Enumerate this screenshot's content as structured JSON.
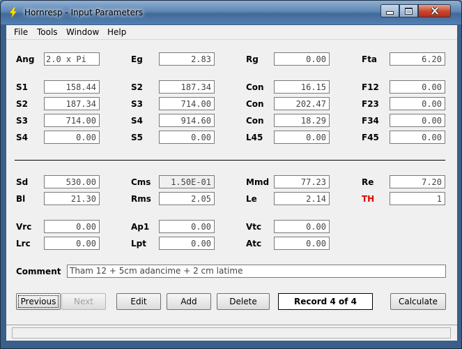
{
  "window": {
    "title": "Hornresp - Input Parameters"
  },
  "menu": [
    "File",
    "Tools",
    "Window",
    "Help"
  ],
  "row1": [
    {
      "label": "Ang",
      "value": "2.0 x Pi"
    },
    {
      "label": "Eg",
      "value": "2.83"
    },
    {
      "label": "Rg",
      "value": "0.00"
    },
    {
      "label": "Fta",
      "value": "6.20"
    }
  ],
  "rows": [
    [
      {
        "label": "S1",
        "value": "158.44"
      },
      {
        "label": "S2",
        "value": "187.34"
      },
      {
        "label": "Con",
        "value": "16.15"
      },
      {
        "label": "F12",
        "value": "0.00"
      }
    ],
    [
      {
        "label": "S2",
        "value": "187.34"
      },
      {
        "label": "S3",
        "value": "714.00"
      },
      {
        "label": "Con",
        "value": "202.47"
      },
      {
        "label": "F23",
        "value": "0.00"
      }
    ],
    [
      {
        "label": "S3",
        "value": "714.00"
      },
      {
        "label": "S4",
        "value": "914.60"
      },
      {
        "label": "Con",
        "value": "18.29"
      },
      {
        "label": "F34",
        "value": "0.00"
      }
    ],
    [
      {
        "label": "S4",
        "value": "0.00"
      },
      {
        "label": "S5",
        "value": "0.00"
      },
      {
        "label": "L45",
        "value": "0.00"
      },
      {
        "label": "F45",
        "value": "0.00"
      }
    ]
  ],
  "driver": [
    [
      {
        "label": "Sd",
        "value": "530.00"
      },
      {
        "label": "Cms",
        "value": "1.50E-01"
      },
      {
        "label": "Mmd",
        "value": "77.23"
      },
      {
        "label": "Re",
        "value": "7.20"
      }
    ],
    [
      {
        "label": "Bl",
        "value": "21.30"
      },
      {
        "label": "Rms",
        "value": "2.05"
      },
      {
        "label": "Le",
        "value": "2.14"
      },
      {
        "label": "TH",
        "value": "1"
      }
    ]
  ],
  "chamber": [
    [
      {
        "label": "Vrc",
        "value": "0.00"
      },
      {
        "label": "Ap1",
        "value": "0.00"
      },
      {
        "label": "Vtc",
        "value": "0.00"
      }
    ],
    [
      {
        "label": "Lrc",
        "value": "0.00"
      },
      {
        "label": "Lpt",
        "value": "0.00"
      },
      {
        "label": "Atc",
        "value": "0.00"
      }
    ]
  ],
  "comment": {
    "label": "Comment",
    "value": "Tham 12 + 5cm adancime + 2 cm latime"
  },
  "buttons": {
    "previous": "Previous",
    "next": "Next",
    "edit": "Edit",
    "add": "Add",
    "delete": "Delete",
    "record": "Record 4 of 4",
    "calculate": "Calculate"
  },
  "colors": {
    "accent_label": "#e00000"
  }
}
